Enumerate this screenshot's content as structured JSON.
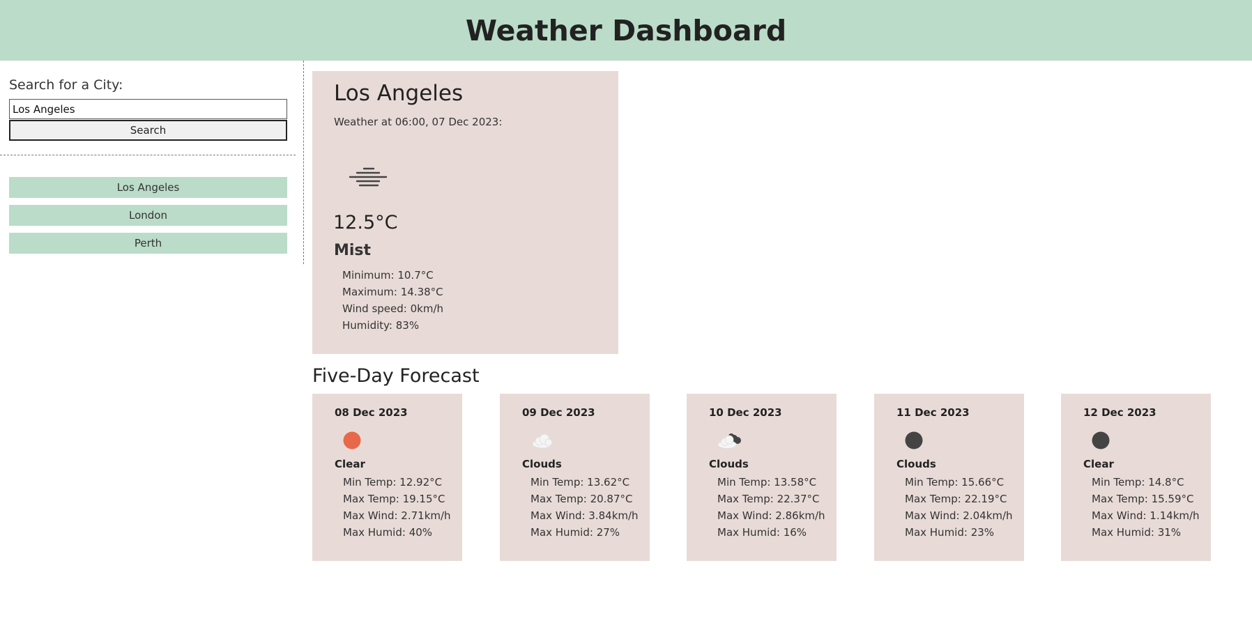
{
  "header": {
    "title": "Weather Dashboard"
  },
  "sidebar": {
    "search_label": "Search for a City:",
    "search_value": "Los Angeles",
    "search_button": "Search",
    "history": [
      {
        "label": "Los Angeles"
      },
      {
        "label": "London"
      },
      {
        "label": "Perth"
      }
    ]
  },
  "current": {
    "city": "Los Angeles",
    "time": "Weather at 06:00, 07 Dec 2023:",
    "icon": "mist-icon",
    "temp": "12.5°C",
    "description": "Mist",
    "minimum": "Minimum: 10.7°C",
    "maximum": "Maximum: 14.38°C",
    "wind": "Wind speed: 0km/h",
    "humidity": "Humidity: 83%"
  },
  "forecast": {
    "title": "Five-Day Forecast",
    "days": [
      {
        "date": "08 Dec 2023",
        "icon": "sun-icon",
        "condition": "Clear",
        "min_temp": "Min Temp: 12.92°C",
        "max_temp": "Max Temp: 19.15°C",
        "max_wind": "Max Wind: 2.71km/h",
        "max_humid": "Max Humid: 40%"
      },
      {
        "date": "09 Dec 2023",
        "icon": "cloud-icon",
        "condition": "Clouds",
        "min_temp": "Min Temp: 13.62°C",
        "max_temp": "Max Temp: 20.87°C",
        "max_wind": "Max Wind: 3.84km/h",
        "max_humid": "Max Humid: 27%"
      },
      {
        "date": "10 Dec 2023",
        "icon": "broken-clouds-icon",
        "condition": "Clouds",
        "min_temp": "Min Temp: 13.58°C",
        "max_temp": "Max Temp: 22.37°C",
        "max_wind": "Max Wind: 2.86km/h",
        "max_humid": "Max Humid: 16%"
      },
      {
        "date": "11 Dec 2023",
        "icon": "night-clouds-icon",
        "condition": "Clouds",
        "min_temp": "Min Temp: 15.66°C",
        "max_temp": "Max Temp: 22.19°C",
        "max_wind": "Max Wind: 2.04km/h",
        "max_humid": "Max Humid: 23%"
      },
      {
        "date": "12 Dec 2023",
        "icon": "moon-icon",
        "condition": "Clear",
        "min_temp": "Min Temp: 14.8°C",
        "max_temp": "Max Temp: 15.59°C",
        "max_wind": "Max Wind: 1.14km/h",
        "max_humid": "Max Humid: 31%"
      }
    ]
  },
  "colors": {
    "header_bg": "#badcc8",
    "card_bg": "#e8dbd7",
    "sun": "#e8694a",
    "dark_disc": "#444444"
  }
}
